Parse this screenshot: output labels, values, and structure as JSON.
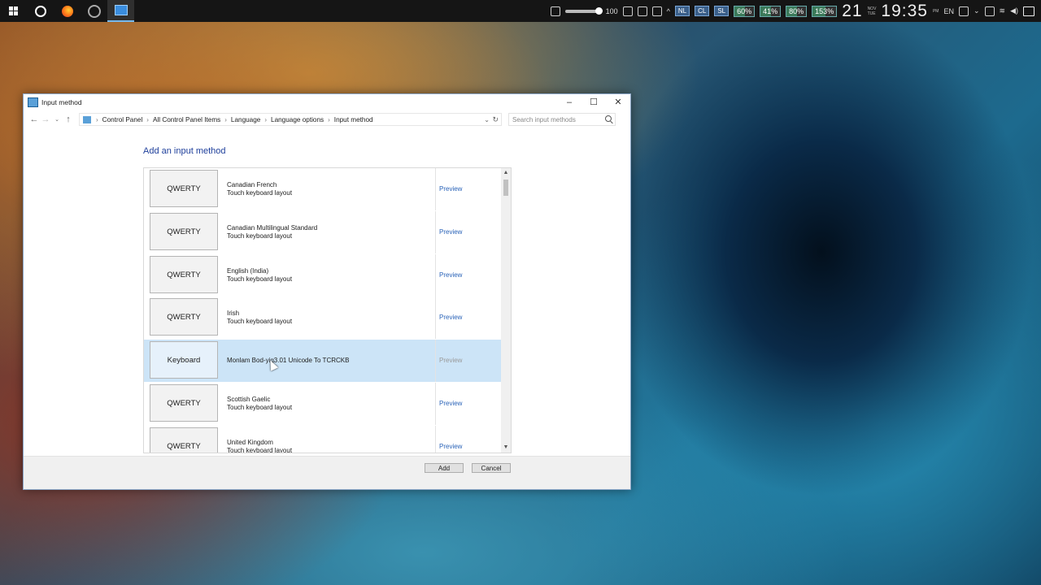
{
  "taskbar": {
    "volume": "100",
    "tiles": [
      "NL",
      "CL",
      "SL"
    ],
    "meters": [
      "60%",
      "41%",
      "80%",
      "153%"
    ],
    "clock": "21",
    "clock_time": "19:35",
    "clock_small": [
      "NOV",
      "TUE",
      "PM"
    ],
    "language": "EN"
  },
  "window": {
    "title": "Input method",
    "breadcrumbs": [
      "Control Panel",
      "All Control Panel Items",
      "Language",
      "Language options",
      "Input method"
    ],
    "search_placeholder": "Search input methods",
    "heading": "Add an input method",
    "items": [
      {
        "tile": "QWERTY",
        "name": "Canadian French",
        "sub": "Touch keyboard layout",
        "preview": "Preview"
      },
      {
        "tile": "QWERTY",
        "name": "Canadian Multilingual Standard",
        "sub": "Touch keyboard layout",
        "preview": "Preview"
      },
      {
        "tile": "QWERTY",
        "name": "English (India)",
        "sub": "Touch keyboard layout",
        "preview": "Preview"
      },
      {
        "tile": "QWERTY",
        "name": "Irish",
        "sub": "Touch keyboard layout",
        "preview": "Preview"
      },
      {
        "tile": "Keyboard",
        "name": "Monlam Bod-yig3.01 Unicode To TCRCKB",
        "sub": "",
        "preview": "Preview"
      },
      {
        "tile": "QWERTY",
        "name": "Scottish Gaelic",
        "sub": "Touch keyboard layout",
        "preview": "Preview"
      },
      {
        "tile": "QWERTY",
        "name": "United Kingdom",
        "sub": "Touch keyboard layout",
        "preview": "Preview"
      }
    ],
    "selected_index": 4,
    "buttons": {
      "add": "Add",
      "cancel": "Cancel"
    }
  },
  "colors": {
    "accent": "#2a63b8",
    "heading": "#1e3f9b",
    "selection": "#cce4f7"
  }
}
